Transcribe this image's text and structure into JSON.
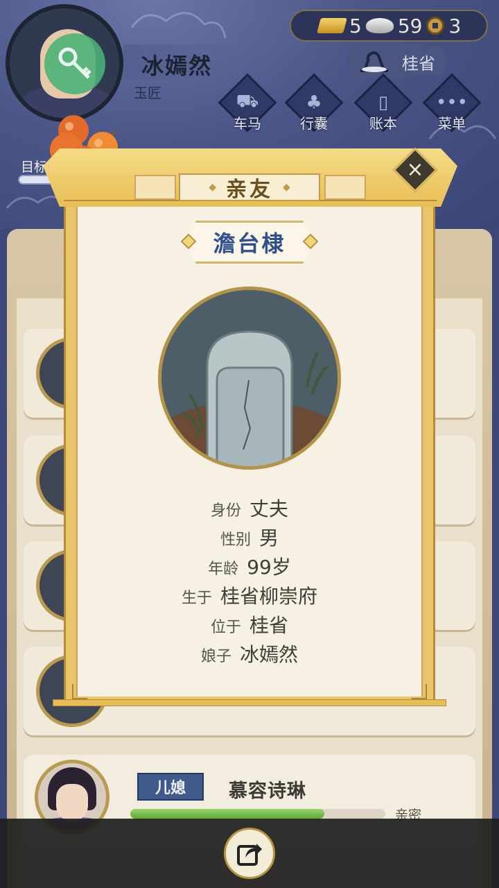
{
  "player": {
    "name": "冰嫣然",
    "title": "玉匠"
  },
  "currency": {
    "gold": "5",
    "silver": "59",
    "copper": "3"
  },
  "location": {
    "label": "桂省"
  },
  "menu": [
    {
      "label": "车马",
      "icon": "carriage-icon"
    },
    {
      "label": "行囊",
      "icon": "bag-icon"
    },
    {
      "label": "账本",
      "icon": "ledger-icon"
    },
    {
      "label": "菜单",
      "icon": "more-icon"
    }
  ],
  "goal": {
    "label": "目标"
  },
  "modal": {
    "title": "亲友",
    "person_name": "澹台棣",
    "portrait": "tombstone",
    "details": [
      {
        "key": "身份",
        "value": "丈夫"
      },
      {
        "key": "性别",
        "value": "男"
      },
      {
        "key": "年龄",
        "value": "99岁"
      },
      {
        "key": "生于",
        "value": "桂省柳崇府"
      },
      {
        "key": "位于",
        "value": "桂省"
      },
      {
        "key": "娘子",
        "value": "冰嫣然"
      }
    ]
  },
  "list_item": {
    "relation": "儿媳",
    "name": "慕容诗琳",
    "intimacy_label": "亲密",
    "intimacy_fraction": 0.76
  },
  "colors": {
    "accent_gold": "#e7bd55",
    "name_blue": "#2f4f8f",
    "tag_blue": "#3f5a8b"
  }
}
